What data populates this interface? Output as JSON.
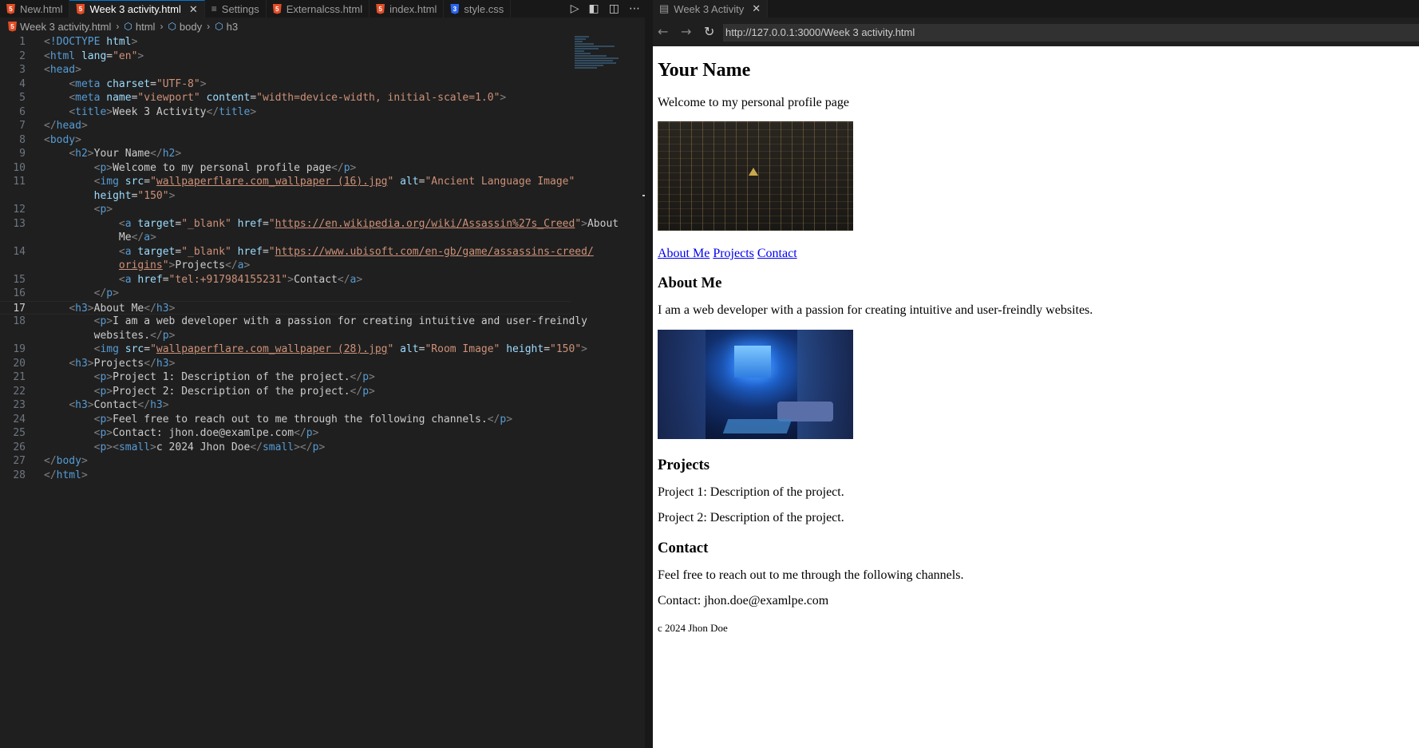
{
  "editor": {
    "tabs": [
      {
        "label": "New.html",
        "icon": "html5-icon"
      },
      {
        "label": "Week 3 activity.html",
        "icon": "html5-icon",
        "active": true
      },
      {
        "label": "Settings",
        "icon": "settings-icon"
      },
      {
        "label": "Externalcss.html",
        "icon": "html5-icon"
      },
      {
        "label": "index.html",
        "icon": "html5-icon"
      },
      {
        "label": "style.css",
        "icon": "css3-icon"
      }
    ],
    "close_glyph": "✕",
    "breadcrumb": {
      "file": "Week 3 activity.html",
      "html": "html",
      "body": "body",
      "h3": "h3"
    },
    "line_numbers": [
      "1",
      "2",
      "3",
      "4",
      "5",
      "6",
      "7",
      "8",
      "9",
      "10",
      "11",
      "",
      "12",
      "13",
      "",
      "14",
      "",
      "15",
      "16",
      "17",
      "18",
      "",
      "19",
      "20",
      "21",
      "22",
      "23",
      "24",
      "25",
      "26",
      "27",
      "28"
    ],
    "current_line": "17"
  },
  "browser": {
    "tab_title": "Week 3 Activity",
    "url": "http://127.0.0.1:3000/Week 3 activity.html",
    "page": {
      "h2": "Your Name",
      "intro": "Welcome to my personal profile page",
      "img1_alt": "Ancient Language Image",
      "links": [
        "About Me",
        "Projects",
        "Contact"
      ],
      "about_heading": "About Me",
      "about_text": "I am a web developer with a passion for creating intuitive and user-freindly websites.",
      "img2_alt": "Room Image",
      "projects_heading": "Projects",
      "project1": "Project 1: Description of the project.",
      "project2": "Project 2: Description of the project.",
      "contact_heading": "Contact",
      "contact_text": "Feel free to reach out to me through the following channels.",
      "contact_email": "Contact: jhon.doe@examlpe.com",
      "copyright": "c 2024 Jhon Doe"
    }
  },
  "colors": {
    "tag": "#569cd6",
    "attr": "#9cdcfe",
    "string": "#ce9178",
    "text": "#cccccc",
    "bracket": "#808080",
    "link": "#0000ee"
  }
}
